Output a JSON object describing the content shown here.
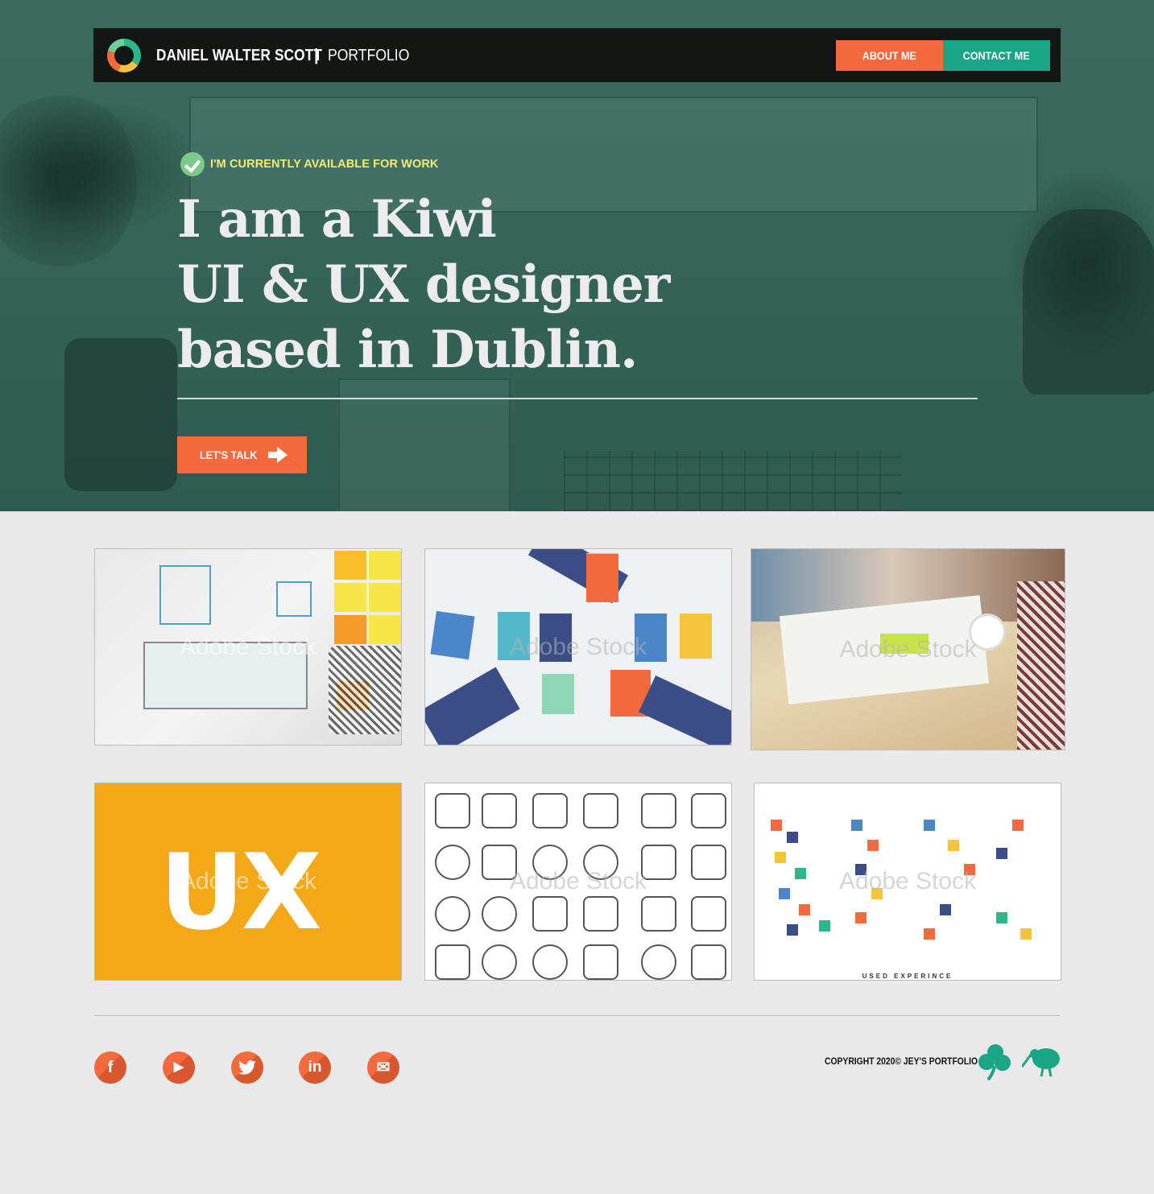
{
  "header": {
    "brand_name": "DANIEL WALTER SCOTT",
    "separator": "|",
    "brand_sub": "PORTFOLIO",
    "about_label": "ABOUT ME",
    "contact_label": "CONTACT ME"
  },
  "hero": {
    "availability": "I'M CURRENTLY AVAILABLE FOR WORK",
    "headline": [
      "I am a Kiwi",
      "UI & UX designer",
      "based in Dublin."
    ],
    "cta_label": "LET'S TALK"
  },
  "gallery": {
    "items": [
      {
        "name": "ux-wireframe-sticky-notes"
      },
      {
        "name": "web-layout-illustration"
      },
      {
        "name": "team-planning-table"
      },
      {
        "name": "ux-letters-yellow",
        "text": "UX"
      },
      {
        "name": "ux-line-icons-grid"
      },
      {
        "name": "user-experience-icon-collage",
        "caption": "USED EXPERINCE"
      }
    ],
    "watermark": "Adobe Stock"
  },
  "footer": {
    "social": [
      {
        "name": "facebook-icon",
        "glyph": "f"
      },
      {
        "name": "youtube-icon",
        "glyph": "▶"
      },
      {
        "name": "twitter-icon",
        "glyph": "🐦"
      },
      {
        "name": "linkedin-icon",
        "glyph": "in"
      },
      {
        "name": "email-icon",
        "glyph": "✉"
      }
    ],
    "copyright": "COPYRIGHT 2020© JEY'S PORTFOLIO"
  },
  "colors": {
    "accent_orange": "#f26a3e",
    "accent_teal": "#1aa686",
    "hero_overlay": "#37655a",
    "availability_yellow": "#f4ea6e",
    "check_green": "#7cc989",
    "ux_yellow": "#f2a817"
  }
}
